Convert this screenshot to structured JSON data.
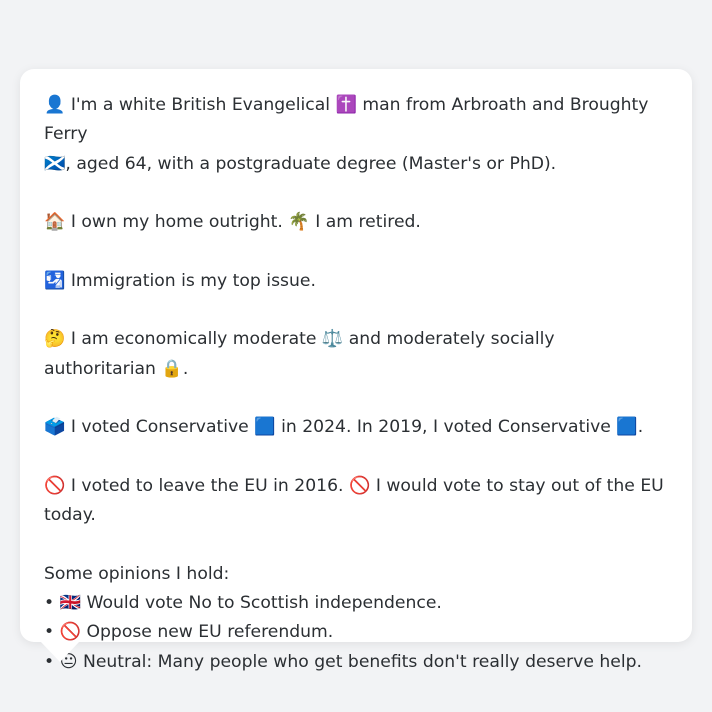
{
  "profile": {
    "identity_line1": "👤 I'm a white British Evangelical ✝️ man from Arbroath and Broughty Ferry",
    "identity_line2": "🏴󠁧󠁢󠁳󠁣󠁴󠁿, aged 64, with a postgraduate degree (Master's or PhD).",
    "housing": "🏠 I own my home outright. 🌴 I am retired.",
    "top_issue": "🛂 Immigration is my top issue.",
    "ideology": "🤔 I am economically moderate ⚖️ and moderately socially authoritarian 🔒.",
    "votes": "🗳️ I voted Conservative 🟦 in 2024. In 2019, I voted Conservative 🟦.",
    "eu_line1": "🚫 I voted to leave the EU in 2016. 🚫 I would vote to stay out of the EU",
    "eu_line2": "today.",
    "opinions_heading": "Some opinions I hold:",
    "opinions": [
      "• 🇬🇧 Would vote No to Scottish independence.",
      "• 🚫 Oppose new EU referendum.",
      "• 😐 Neutral: Many people who get benefits don't really deserve help."
    ]
  }
}
